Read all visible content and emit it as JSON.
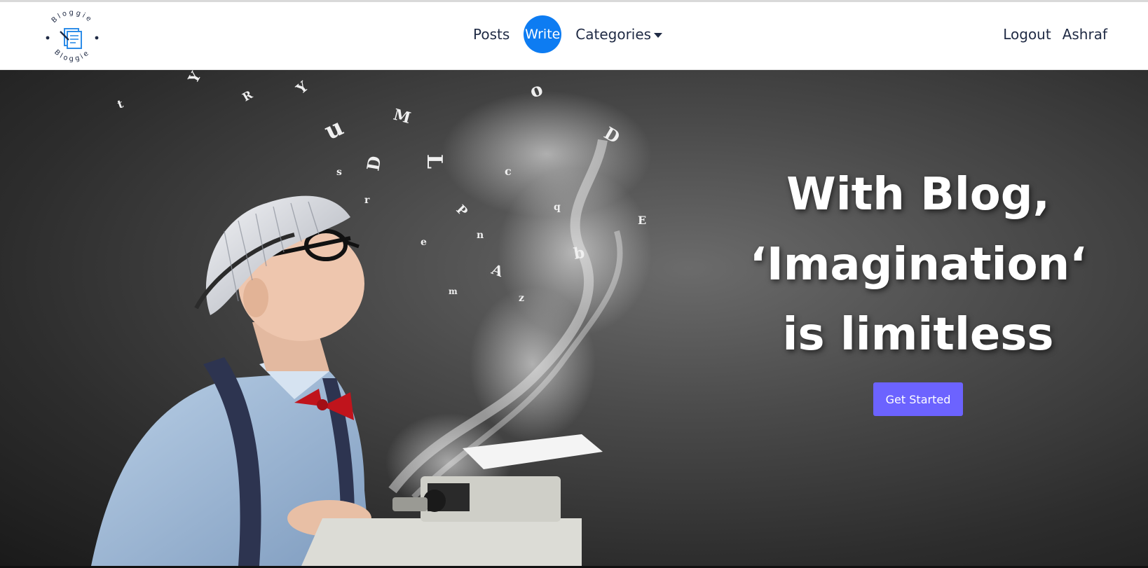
{
  "brand": {
    "logo_ring_text_top": "Bloggie",
    "logo_ring_text_bottom": "Bloggie",
    "logo_icon": "document-pen-icon",
    "accent_color": "#0d7cf2"
  },
  "nav": {
    "posts": "Posts",
    "write": "Write",
    "categories": "Categories",
    "logout": "Logout",
    "user": "Ashraf"
  },
  "hero": {
    "headline_line1": "With Blog,",
    "headline_line2": "‘Imagination‘",
    "headline_line3": "is limitless",
    "cta_label": "Get Started",
    "cta_color": "#6c63ff"
  }
}
